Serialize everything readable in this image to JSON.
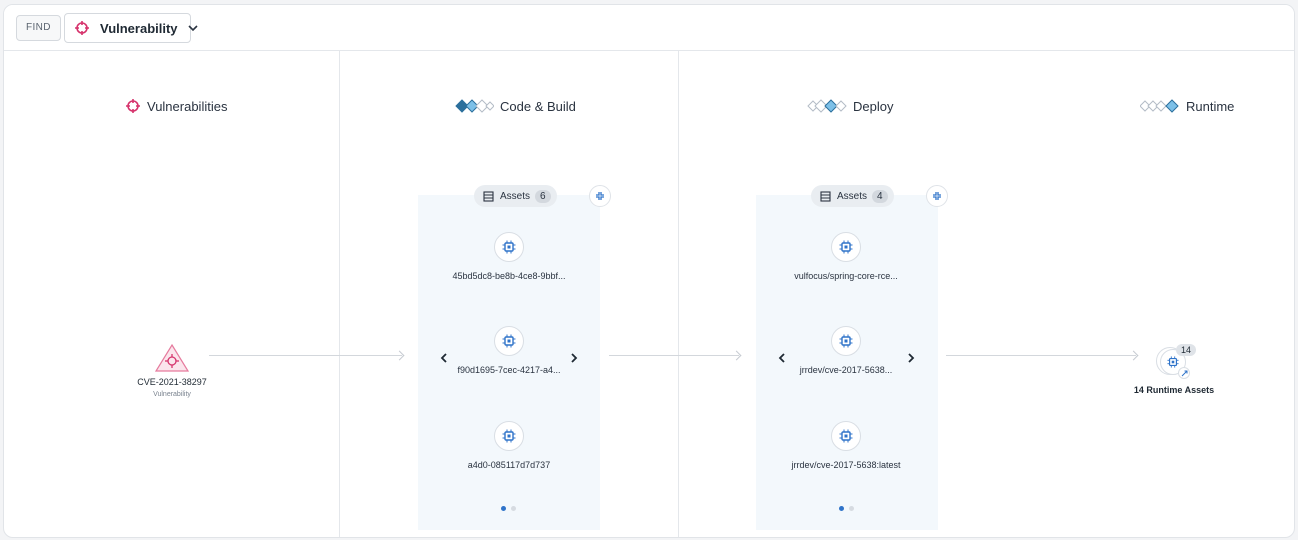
{
  "toolbar": {
    "find_label": "FIND",
    "selected_type": "Vulnerability"
  },
  "stages": {
    "vulnerabilities": {
      "title": "Vulnerabilities"
    },
    "code_build": {
      "title": "Code & Build",
      "assets_label": "Assets",
      "assets_count": "6",
      "items": [
        "45bd5dc8-be8b-4ce8-9bbf...",
        "f90d1695-7cec-4217-a4...",
        "a4d0-085117d7d737"
      ]
    },
    "deploy": {
      "title": "Deploy",
      "assets_label": "Assets",
      "assets_count": "4",
      "items": [
        "vulfocus/spring-core-rce...",
        "jrrdev/cve-2017-5638...",
        "jrrdev/cve-2017-5638:latest"
      ]
    },
    "runtime": {
      "title": "Runtime",
      "count": "14",
      "label": "14 Runtime Assets"
    }
  },
  "vulnerability": {
    "id": "CVE-2021-38297",
    "type": "Vulnerability"
  },
  "colors": {
    "accent_red": "#d6336c",
    "chip_blue": "#2f73c9",
    "panel_bg": "#f3f8fc"
  },
  "icons": {
    "target": "crosshair-icon",
    "chip": "chip-icon",
    "stage": "diamond-stage-icon",
    "assets": "list-icon",
    "collapse": "collapse-icon"
  }
}
